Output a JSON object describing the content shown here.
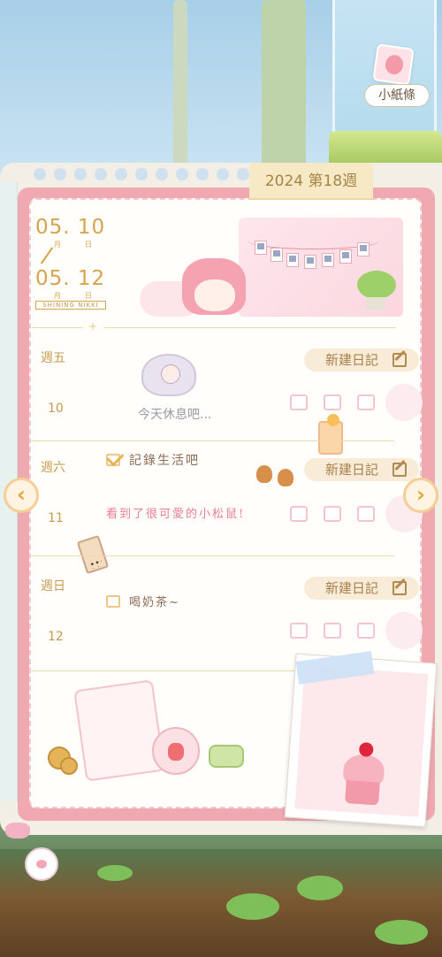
{
  "note": {
    "label": "小紙條"
  },
  "week": {
    "label": "2024 第18週"
  },
  "date_range": {
    "start": "05. 10",
    "end": "05. 12",
    "month_unit": "月",
    "day_unit": "日",
    "brand": "SHINING NIKKI"
  },
  "days": [
    {
      "weekday": "週五",
      "date": "10",
      "new_entry_label": "新建日記",
      "rest_text": "今天休息吧..."
    },
    {
      "weekday": "週六",
      "date": "11",
      "new_entry_label": "新建日記",
      "todo": {
        "text": "記錄生活吧",
        "checked": true
      },
      "note": "看到了很可愛的小松鼠!"
    },
    {
      "weekday": "週日",
      "date": "12",
      "new_entry_label": "新建日記",
      "todo": {
        "text": "喝奶茶~",
        "checked": false
      }
    }
  ],
  "icons": {
    "prev": "chevron-left-icon",
    "next": "chevron-right-icon",
    "edit": "pencil-icon"
  },
  "colors": {
    "accent_gold": "#d6a44f",
    "planner_pink": "#f1a9b1",
    "button_bg": "#f8ecd9"
  }
}
